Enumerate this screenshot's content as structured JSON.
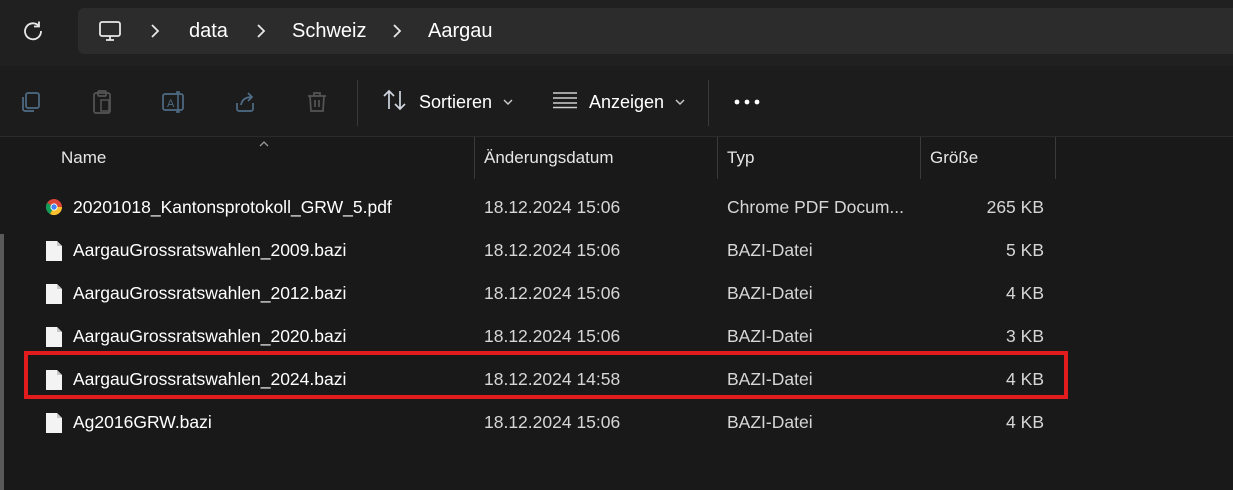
{
  "address_bar": {
    "breadcrumbs": [
      "data",
      "Schweiz",
      "Aargau"
    ],
    "root_icon": "computer-icon",
    "refresh_icon": "refresh-icon"
  },
  "toolbar": {
    "icons": [
      "copy-icon",
      "paste-icon",
      "rename-icon",
      "share-icon",
      "delete-icon"
    ],
    "sort_label": "Sortieren",
    "view_label": "Anzeigen",
    "more_icon": "more-icon"
  },
  "columns": {
    "name": "Name",
    "modified": "Änderungsdatum",
    "type": "Typ",
    "size": "Größe"
  },
  "files": [
    {
      "name": "20201018_Kantonsprotokoll_GRW_5.pdf",
      "modified": "18.12.2024 15:06",
      "type": "Chrome PDF Docum...",
      "size": "265 KB",
      "icon": "chrome-pdf-icon"
    },
    {
      "name": "AargauGrossratswahlen_2009.bazi",
      "modified": "18.12.2024 15:06",
      "type": "BAZI-Datei",
      "size": "5 KB",
      "icon": "file-icon"
    },
    {
      "name": "AargauGrossratswahlen_2012.bazi",
      "modified": "18.12.2024 15:06",
      "type": "BAZI-Datei",
      "size": "4 KB",
      "icon": "file-icon"
    },
    {
      "name": "AargauGrossratswahlen_2020.bazi",
      "modified": "18.12.2024 15:06",
      "type": "BAZI-Datei",
      "size": "3 KB",
      "icon": "file-icon"
    },
    {
      "name": "AargauGrossratswahlen_2024.bazi",
      "modified": "18.12.2024 14:58",
      "type": "BAZI-Datei",
      "size": "4 KB",
      "icon": "file-icon",
      "highlighted": true
    },
    {
      "name": "Ag2016GRW.bazi",
      "modified": "18.12.2024 15:06",
      "type": "BAZI-Datei",
      "size": "4 KB",
      "icon": "file-icon"
    }
  ],
  "colors": {
    "highlight": "#e21c1c",
    "background": "#191919"
  }
}
